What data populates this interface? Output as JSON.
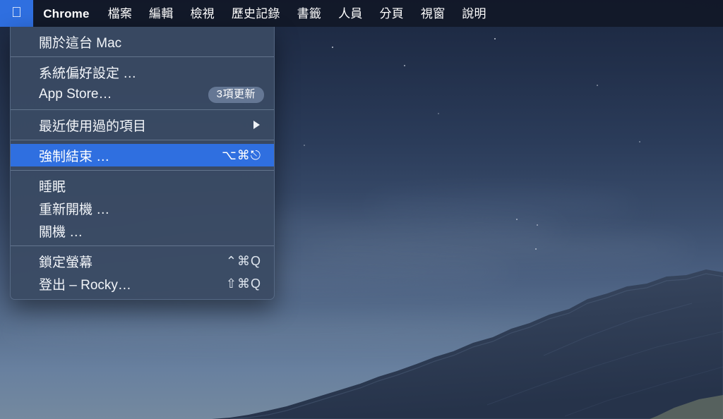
{
  "desktop": {
    "wallpaper_name": "mojave-night-mountains",
    "sky_top_color": "#1b2740",
    "sky_bottom_color": "#74899f",
    "ridge_color": "#2b3850"
  },
  "menubar": {
    "background_color": "#111726",
    "apple_icon": "apple-logo-icon",
    "apple_glyph": "",
    "highlight_color": "#2f6fe0",
    "items": [
      {
        "label": "Chrome",
        "bold": true
      },
      {
        "label": "檔案",
        "bold": false
      },
      {
        "label": "編輯",
        "bold": false
      },
      {
        "label": "檢視",
        "bold": false
      },
      {
        "label": "歷史記錄",
        "bold": false
      },
      {
        "label": "書籤",
        "bold": false
      },
      {
        "label": "人員",
        "bold": false
      },
      {
        "label": "分頁",
        "bold": false
      },
      {
        "label": "視窗",
        "bold": false
      },
      {
        "label": "說明",
        "bold": false
      }
    ]
  },
  "apple_menu": {
    "background_color": "#3a4a63",
    "highlight_color": "#2f6fe0",
    "groups": [
      {
        "items": [
          {
            "id": "about-this-mac",
            "label": "關於這台 Mac",
            "shortcut": "",
            "badge": "",
            "submenu": false,
            "highlighted": false
          }
        ]
      },
      {
        "items": [
          {
            "id": "system-preferences",
            "label": "系統偏好設定 …",
            "shortcut": "",
            "badge": "",
            "submenu": false,
            "highlighted": false
          },
          {
            "id": "app-store",
            "label": "App Store…",
            "shortcut": "",
            "badge": "3項更新",
            "submenu": false,
            "highlighted": false
          }
        ]
      },
      {
        "items": [
          {
            "id": "recent-items",
            "label": "最近使用過的項目",
            "shortcut": "",
            "badge": "",
            "submenu": true,
            "highlighted": false
          }
        ]
      },
      {
        "items": [
          {
            "id": "force-quit",
            "label": "強制結束 …",
            "shortcut": "⌥⌘⎋",
            "badge": "",
            "submenu": false,
            "highlighted": true
          }
        ]
      },
      {
        "items": [
          {
            "id": "sleep",
            "label": "睡眠",
            "shortcut": "",
            "badge": "",
            "submenu": false,
            "highlighted": false
          },
          {
            "id": "restart",
            "label": "重新開機 …",
            "shortcut": "",
            "badge": "",
            "submenu": false,
            "highlighted": false
          },
          {
            "id": "shut-down",
            "label": "關機 …",
            "shortcut": "",
            "badge": "",
            "submenu": false,
            "highlighted": false
          }
        ]
      },
      {
        "items": [
          {
            "id": "lock-screen",
            "label": "鎖定螢幕",
            "shortcut": "⌃⌘Q",
            "badge": "",
            "submenu": false,
            "highlighted": false
          },
          {
            "id": "log-out",
            "label": "登出 – Rocky…",
            "shortcut": "⇧⌘Q",
            "badge": "",
            "submenu": false,
            "highlighted": false
          }
        ]
      }
    ]
  }
}
